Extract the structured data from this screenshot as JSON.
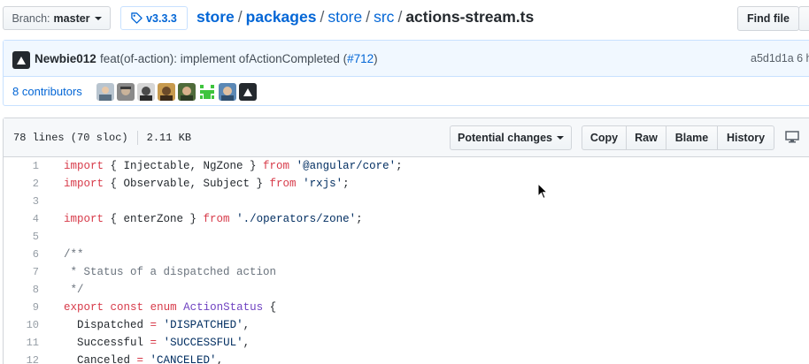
{
  "topbar": {
    "branch_label": "Branch:",
    "branch_name": "master",
    "tag": "v3.3.3",
    "breadcrumb": [
      "store",
      "packages",
      "store",
      "src"
    ],
    "separator": "/",
    "filename": "actions-stream.ts",
    "find_file": "Find file"
  },
  "commit": {
    "author": "Newbie012",
    "message": "feat(of-action): implement ofActionCompleted (",
    "pr": "#712",
    "message_end": ")",
    "sha": "a5d1d1a 6 h"
  },
  "contributors": {
    "count": "8",
    "label": "contributors"
  },
  "file": {
    "lines_info": "78 lines (70 sloc)",
    "size": "2.11 KB",
    "potential_changes": "Potential changes",
    "copy": "Copy",
    "raw": "Raw",
    "blame": "Blame",
    "history": "History"
  },
  "code": [
    {
      "n": "1",
      "parts": [
        [
          "k",
          "import"
        ],
        [
          "p",
          " { Injectable, NgZone } "
        ],
        [
          "k",
          "from"
        ],
        [
          "p",
          " "
        ],
        [
          "s",
          "'@angular/core'"
        ],
        [
          "p",
          ";"
        ]
      ]
    },
    {
      "n": "2",
      "parts": [
        [
          "k",
          "import"
        ],
        [
          "p",
          " { Observable, Subject } "
        ],
        [
          "k",
          "from"
        ],
        [
          "p",
          " "
        ],
        [
          "s",
          "'rxjs'"
        ],
        [
          "p",
          ";"
        ]
      ]
    },
    {
      "n": "3",
      "parts": []
    },
    {
      "n": "4",
      "parts": [
        [
          "k",
          "import"
        ],
        [
          "p",
          " { enterZone } "
        ],
        [
          "k",
          "from"
        ],
        [
          "p",
          " "
        ],
        [
          "s",
          "'./operators/zone'"
        ],
        [
          "p",
          ";"
        ]
      ]
    },
    {
      "n": "5",
      "parts": []
    },
    {
      "n": "6",
      "parts": [
        [
          "c",
          "/**"
        ]
      ]
    },
    {
      "n": "7",
      "parts": [
        [
          "c",
          " * Status of a dispatched action"
        ]
      ]
    },
    {
      "n": "8",
      "parts": [
        [
          "c",
          " */"
        ]
      ]
    },
    {
      "n": "9",
      "parts": [
        [
          "k",
          "export"
        ],
        [
          "p",
          " "
        ],
        [
          "k",
          "const"
        ],
        [
          "p",
          " "
        ],
        [
          "k",
          "enum"
        ],
        [
          "p",
          " "
        ],
        [
          "t",
          "ActionStatus"
        ],
        [
          "p",
          " {"
        ]
      ]
    },
    {
      "n": "10",
      "parts": [
        [
          "p",
          "  Dispatched "
        ],
        [
          "k",
          "="
        ],
        [
          "p",
          " "
        ],
        [
          "s",
          "'DISPATCHED'"
        ],
        [
          "p",
          ","
        ]
      ]
    },
    {
      "n": "11",
      "parts": [
        [
          "p",
          "  Successful "
        ],
        [
          "k",
          "="
        ],
        [
          "p",
          " "
        ],
        [
          "s",
          "'SUCCESSFUL'"
        ],
        [
          "p",
          ","
        ]
      ]
    },
    {
      "n": "12",
      "parts": [
        [
          "p",
          "  Canceled "
        ],
        [
          "k",
          "="
        ],
        [
          "p",
          " "
        ],
        [
          "s",
          "'CANCELED'"
        ],
        [
          "p",
          ","
        ]
      ]
    }
  ]
}
